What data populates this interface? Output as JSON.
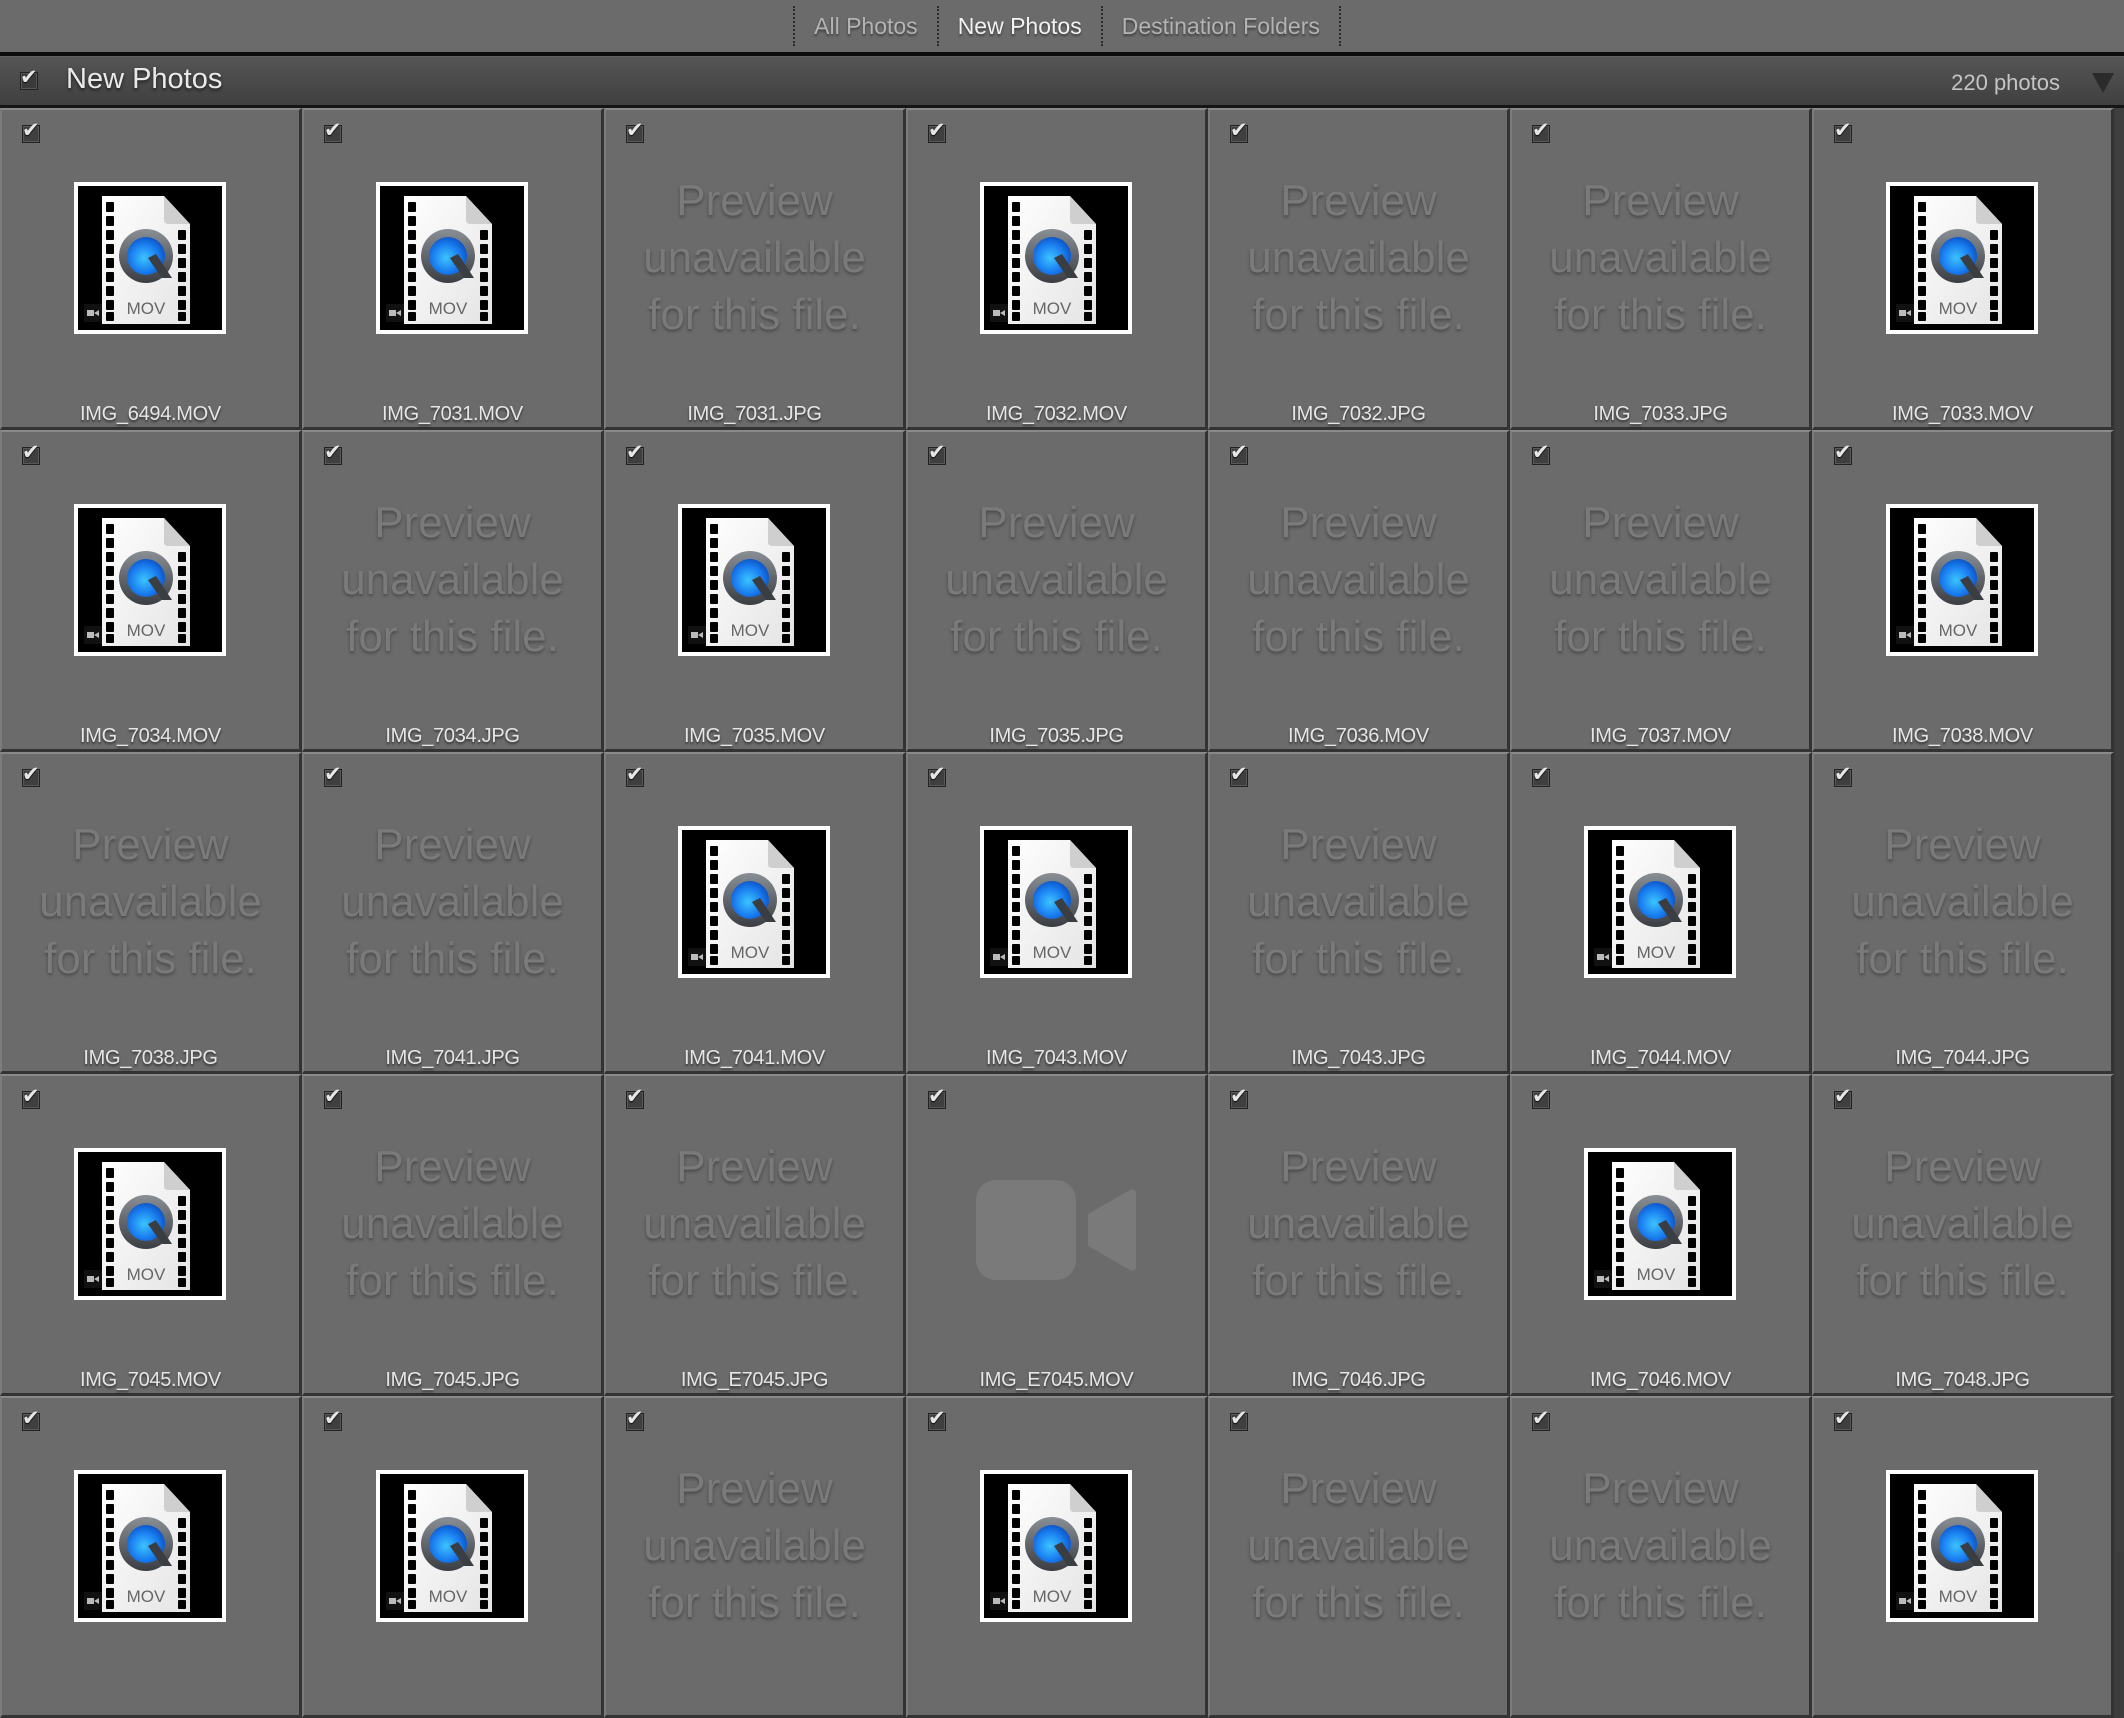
{
  "tabs": [
    {
      "label": "All Photos",
      "active": false
    },
    {
      "label": "New Photos",
      "active": true
    },
    {
      "label": "Destination Folders",
      "active": false
    }
  ],
  "section": {
    "title": "New Photos",
    "checked": true,
    "count_label": "220 photos",
    "collapse_icon": "triangle-down-icon"
  },
  "preview_unavailable_text": [
    "Preview",
    "unavailable",
    "for this file."
  ],
  "mov_badge_label": "MOV",
  "check_glyph": "✔",
  "photos": [
    {
      "name": "IMG_6494.MOV",
      "type": "mov",
      "checked": true
    },
    {
      "name": "IMG_7031.MOV",
      "type": "mov",
      "checked": true
    },
    {
      "name": "IMG_7031.JPG",
      "type": "unavailable",
      "checked": true
    },
    {
      "name": "IMG_7032.MOV",
      "type": "mov",
      "checked": true
    },
    {
      "name": "IMG_7032.JPG",
      "type": "unavailable",
      "checked": true
    },
    {
      "name": "IMG_7033.JPG",
      "type": "unavailable",
      "checked": true
    },
    {
      "name": "IMG_7033.MOV",
      "type": "mov",
      "checked": true
    },
    {
      "name": "IMG_7034.MOV",
      "type": "mov",
      "checked": true
    },
    {
      "name": "IMG_7034.JPG",
      "type": "unavailable",
      "checked": true
    },
    {
      "name": "IMG_7035.MOV",
      "type": "mov",
      "checked": true
    },
    {
      "name": "IMG_7035.JPG",
      "type": "unavailable",
      "checked": true
    },
    {
      "name": "IMG_7036.MOV",
      "type": "unavailable",
      "checked": true
    },
    {
      "name": "IMG_7037.MOV",
      "type": "unavailable",
      "checked": true
    },
    {
      "name": "IMG_7038.MOV",
      "type": "mov",
      "checked": true
    },
    {
      "name": "IMG_7038.JPG",
      "type": "unavailable",
      "checked": true
    },
    {
      "name": "IMG_7041.JPG",
      "type": "unavailable",
      "checked": true
    },
    {
      "name": "IMG_7041.MOV",
      "type": "mov",
      "checked": true
    },
    {
      "name": "IMG_7043.MOV",
      "type": "mov",
      "checked": true
    },
    {
      "name": "IMG_7043.JPG",
      "type": "unavailable",
      "checked": true
    },
    {
      "name": "IMG_7044.MOV",
      "type": "mov",
      "checked": true
    },
    {
      "name": "IMG_7044.JPG",
      "type": "unavailable",
      "checked": true
    },
    {
      "name": "IMG_7045.MOV",
      "type": "mov",
      "checked": true
    },
    {
      "name": "IMG_7045.JPG",
      "type": "unavailable",
      "checked": true
    },
    {
      "name": "IMG_E7045.JPG",
      "type": "unavailable",
      "checked": true
    },
    {
      "name": "IMG_E7045.MOV",
      "type": "video-placeholder",
      "checked": true
    },
    {
      "name": "IMG_7046.JPG",
      "type": "unavailable",
      "checked": true
    },
    {
      "name": "IMG_7046.MOV",
      "type": "mov",
      "checked": true
    },
    {
      "name": "IMG_7048.JPG",
      "type": "unavailable",
      "checked": true
    },
    {
      "name": "",
      "type": "mov",
      "checked": true
    },
    {
      "name": "",
      "type": "mov",
      "checked": true
    },
    {
      "name": "",
      "type": "unavailable",
      "checked": true
    },
    {
      "name": "",
      "type": "mov",
      "checked": true
    },
    {
      "name": "",
      "type": "unavailable",
      "checked": true
    },
    {
      "name": "",
      "type": "unavailable",
      "checked": true
    },
    {
      "name": "",
      "type": "mov",
      "checked": true
    }
  ]
}
